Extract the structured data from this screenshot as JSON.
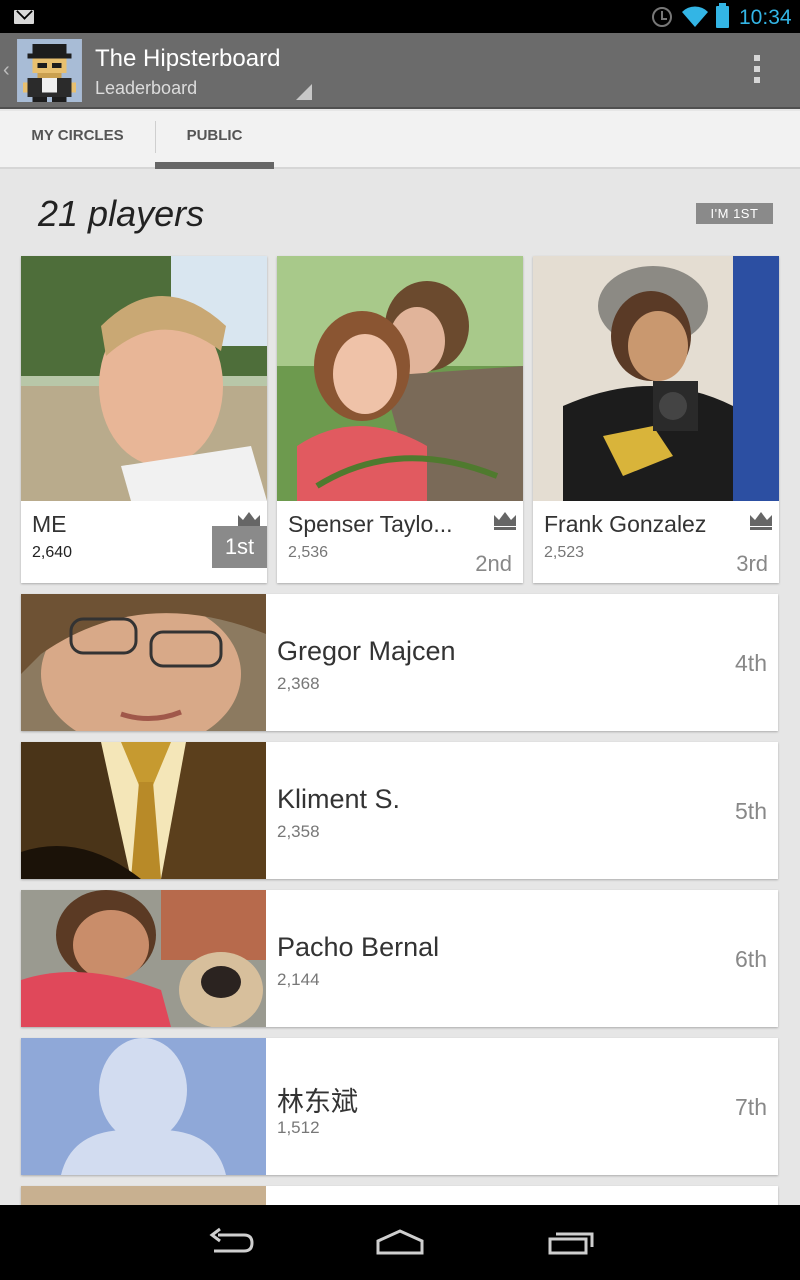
{
  "status_bar": {
    "time": "10:34",
    "icons": [
      "mail-icon",
      "alarm-icon",
      "wifi-icon",
      "battery-icon"
    ]
  },
  "action_bar": {
    "title": "The Hipsterboard",
    "subtitle": "Leaderboard"
  },
  "tabs": [
    {
      "label": "MY CIRCLES",
      "selected": false
    },
    {
      "label": "PUBLIC",
      "selected": true
    }
  ],
  "leaderboard": {
    "player_count": "21 players",
    "my_rank_badge": "I'M 1ST",
    "top_players": [
      {
        "name": "ME",
        "score": "2,640",
        "rank": "1st"
      },
      {
        "name": "Spenser Taylo...",
        "score": "2,536",
        "rank": "2nd"
      },
      {
        "name": "Frank Gonzalez",
        "score": "2,523",
        "rank": "3rd"
      }
    ],
    "players": [
      {
        "name": "Gregor Majcen",
        "score": "2,368",
        "rank": "4th"
      },
      {
        "name": "Kliment S.",
        "score": "2,358",
        "rank": "5th"
      },
      {
        "name": "Pacho Bernal",
        "score": "2,144",
        "rank": "6th"
      },
      {
        "name": "林东斌",
        "score": "1,512",
        "rank": "7th"
      }
    ]
  },
  "colors": {
    "accent": "#33b5e5",
    "action_bar": "#6b6b6b",
    "badge": "#8a8a8a"
  }
}
